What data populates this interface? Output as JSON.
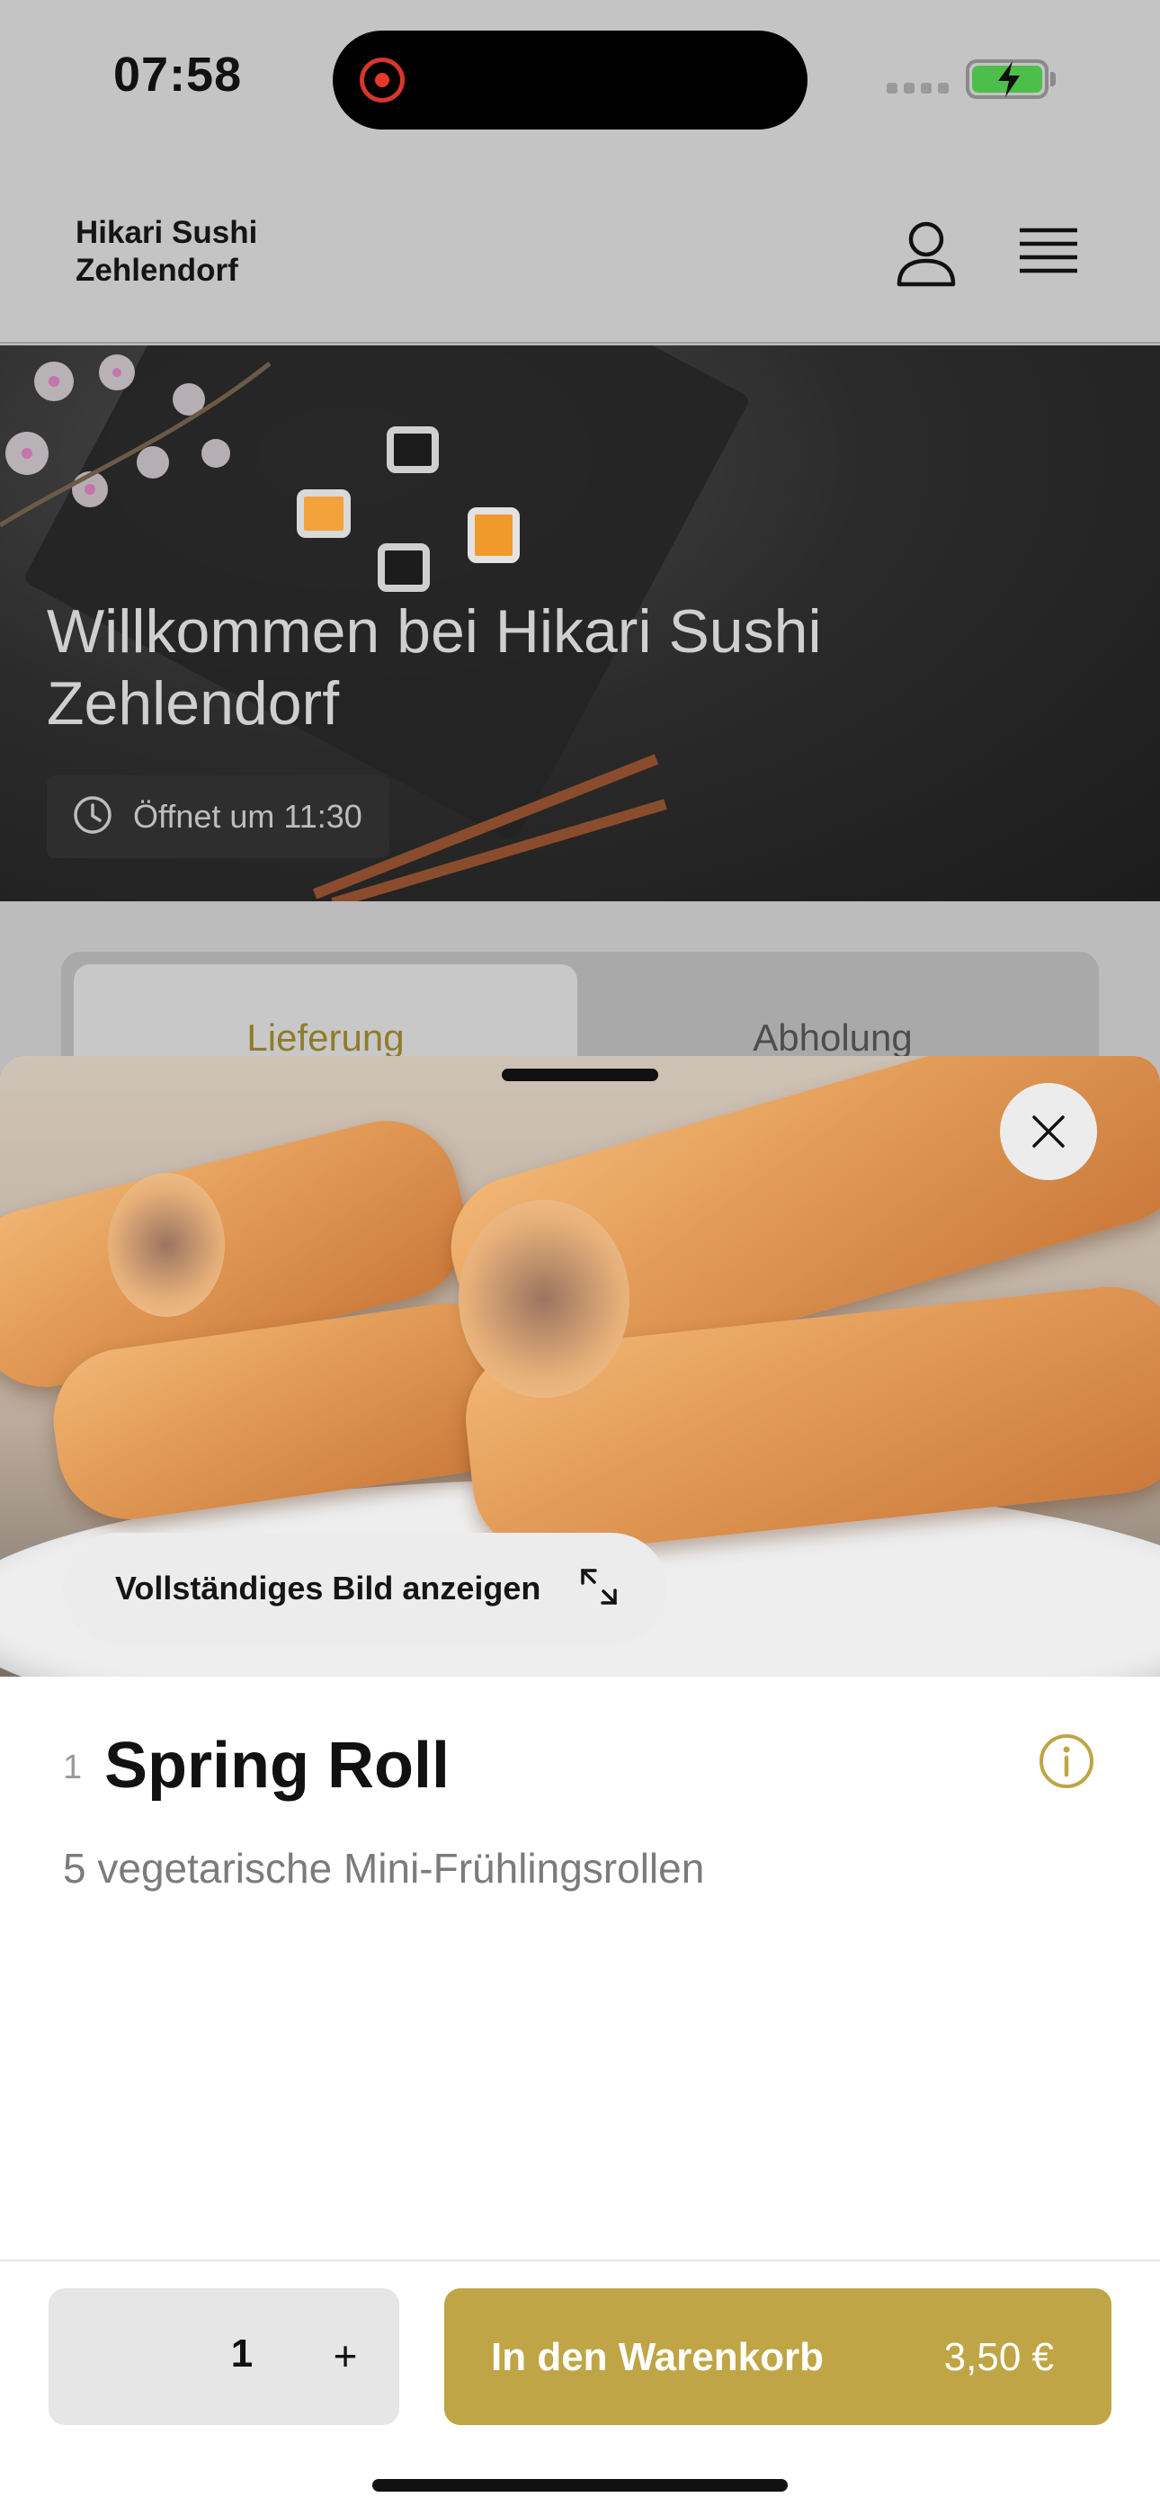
{
  "status_bar": {
    "time": "07:58"
  },
  "header": {
    "brand": "Hikari Sushi\nZehlendorf"
  },
  "hero": {
    "title": "Willkommen bei Hikari Sushi Zehlendorf",
    "hours": "Öffnet um 11:30"
  },
  "order_mode": {
    "tabs": [
      "Lieferung",
      "Abholung"
    ],
    "active": "Lieferung"
  },
  "sheet": {
    "full_image_label": "Vollständiges Bild anzeigen",
    "item_number": "1",
    "item_title": "Spring Roll",
    "item_description": "5 vegetarische Mini-Frühlingsrollen"
  },
  "footer": {
    "quantity": "1",
    "plus": "+",
    "add_label": "In den Warenkorb",
    "price": "3,50 €"
  },
  "colors": {
    "accent": "#bfa545",
    "accent_text": "#8f7c2a",
    "sheet_bg": "#ffffff",
    "dim_bg": "#bdbdbd"
  },
  "icons": [
    "record-icon",
    "signal-icon",
    "battery-icon",
    "user-icon",
    "menu-icon",
    "clock-icon",
    "close-icon",
    "expand-icon",
    "info-icon"
  ]
}
